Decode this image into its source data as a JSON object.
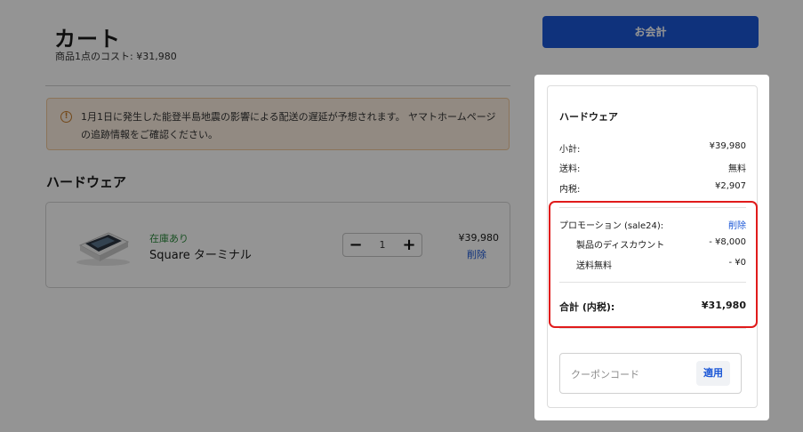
{
  "cart": {
    "title": "カート",
    "subtitle": "商品1点のコスト: ¥31,980"
  },
  "notice": {
    "icon": "info-circle-icon",
    "text": "1月1日に発生した能登半島地震の影響による配送の遅延が予想されます。 ヤマトホームページの追跡情報をご確認ください。"
  },
  "section": {
    "heading": "ハードウェア"
  },
  "item": {
    "stock": "在庫あり",
    "name": "Square ターミナル",
    "quantity": "1",
    "minus": "−",
    "plus": "+",
    "price": "¥39,980",
    "remove": "削除"
  },
  "checkout": {
    "label": "お会計"
  },
  "summary": {
    "title": "ハードウェア",
    "subtotal_label": "小計:",
    "subtotal_value": "¥39,980",
    "shipping_label": "送料:",
    "shipping_value": "無料",
    "tax_label": "内税:",
    "tax_value": "¥2,907",
    "promo_label": "プロモーション (sale24):",
    "promo_remove": "削除",
    "discount_label": "製品のディスカウント",
    "discount_value": "- ¥8,000",
    "freeship_label": "送料無料",
    "freeship_value": "- ¥0",
    "total_label": "合計 (内税):",
    "total_value": "¥31,980"
  },
  "coupon": {
    "placeholder": "クーポンコード",
    "apply": "適用"
  },
  "colors": {
    "accent": "#1a56d6",
    "highlight": "#e01b1b",
    "in_stock": "#2e8b3e",
    "notice_bg": "#fbeee0"
  }
}
